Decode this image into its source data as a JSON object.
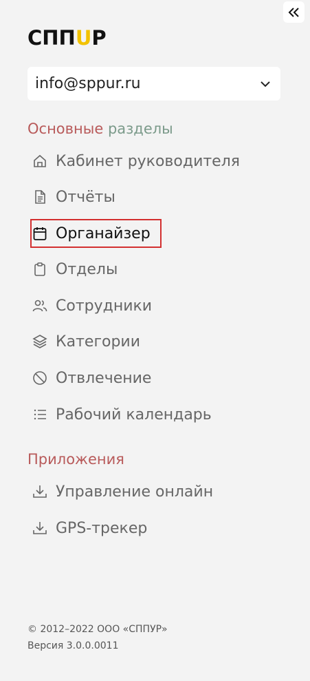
{
  "logo": {
    "text_left": "СПП",
    "text_mid": "U",
    "text_right": "Р",
    "accent": "#f2c200"
  },
  "account": {
    "email": "info@sppur.ru"
  },
  "main_section": {
    "title_part1": "Основные",
    "title_part2": " разделы",
    "items": [
      {
        "label": "Кабинет руководителя",
        "icon": "home-icon"
      },
      {
        "label": "Отчёты",
        "icon": "document-icon"
      },
      {
        "label": "Органайзер",
        "icon": "calendar-icon"
      },
      {
        "label": "Отделы",
        "icon": "clipboard-icon"
      },
      {
        "label": "Сотрудники",
        "icon": "users-icon"
      },
      {
        "label": "Категории",
        "icon": "layers-icon"
      },
      {
        "label": "Отвлечение",
        "icon": "ban-icon"
      },
      {
        "label": "Рабочий календарь",
        "icon": "list-icon"
      }
    ]
  },
  "apps_section": {
    "title": "Приложения",
    "items": [
      {
        "label": "Управление онлайн",
        "icon": "download-icon"
      },
      {
        "label": "GPS-трекер",
        "icon": "download-icon"
      }
    ]
  },
  "footer": {
    "copyright": "© 2012–2022 ООО «СППУР»",
    "version": "Версия 3.0.0.0011"
  },
  "colors": {
    "section_red": "#b85a5a",
    "section_green": "#7b9a8a",
    "highlight": "#d32f2f"
  }
}
